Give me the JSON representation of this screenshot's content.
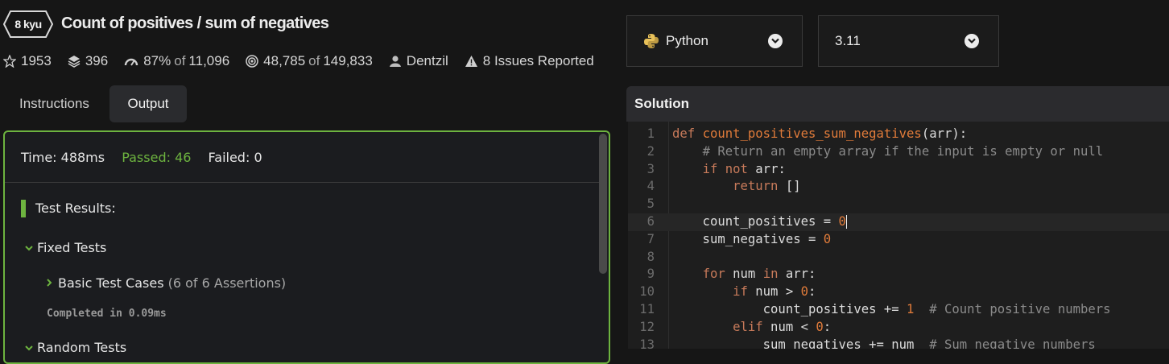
{
  "kata": {
    "kyu": "8 kyu",
    "title": "Count of positives / sum of negatives"
  },
  "stats": {
    "stars": "1953",
    "collections": "396",
    "satisfaction": "87%",
    "satisfaction_of": "of",
    "votes": "11,096",
    "completed": "48,785",
    "completed_of": "of",
    "attempts": "149,833",
    "author": "Dentzil",
    "issues": "8 Issues Reported"
  },
  "tabs": {
    "instructions": "Instructions",
    "output": "Output"
  },
  "output": {
    "time": "Time: 488ms",
    "passed": "Passed: 46",
    "failed": "Failed: 0",
    "results_heading": "Test Results:",
    "groups": [
      {
        "label": "Fixed Tests"
      },
      {
        "label": "Basic Test Cases",
        "assertions": "(6 of 6 Assertions)",
        "completed": "Completed in 0.09ms"
      },
      {
        "label": "Random Tests"
      }
    ]
  },
  "language_select": {
    "value": "Python",
    "icon": "python-icon"
  },
  "version_select": {
    "value": "3.11"
  },
  "solution": {
    "title": "Solution",
    "active_line": 6,
    "line_numbers": [
      "1",
      "2",
      "3",
      "4",
      "5",
      "6",
      "7",
      "8",
      "9",
      "10",
      "11",
      "12",
      "13"
    ],
    "lines": [
      "def count_positives_sum_negatives(arr):",
      "    # Return an empty array if the input is empty or null",
      "    if not arr:",
      "        return []",
      "",
      "    count_positives = 0",
      "    sum_negatives = 0",
      "",
      "    for num in arr:",
      "        if num > 0:",
      "            count_positives += 1  # Count positive numbers",
      "        elif num < 0:",
      "            sum_negatives += num  # Sum negative numbers"
    ]
  },
  "colors": {
    "accent_green": "#6db33f",
    "keyword": "#c77a5a",
    "number": "#e07b3a",
    "comment": "#8a8a8a"
  }
}
